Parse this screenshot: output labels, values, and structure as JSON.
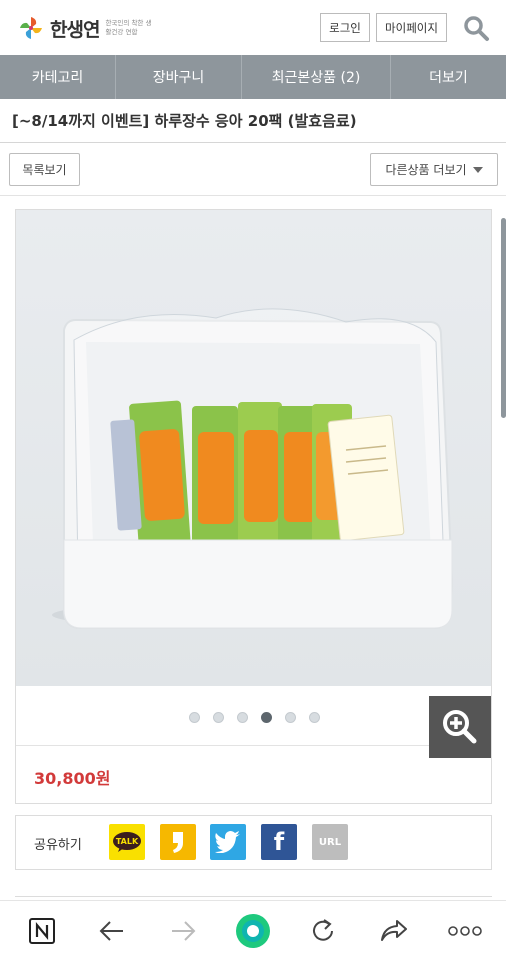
{
  "header": {
    "logo_text": "한생연",
    "logo_sub": "한국인의 착한 생활건강 연합",
    "login_label": "로그인",
    "mypage_label": "마이페이지",
    "search_icon": "search-icon"
  },
  "nav": {
    "items": [
      {
        "label": "카테고리"
      },
      {
        "label": "장바구니"
      },
      {
        "label": "최근본상품 (2)"
      },
      {
        "label": "더보기"
      }
    ]
  },
  "product": {
    "title": "[~8/14까지 이벤트] 하루장수 응아 20팩 (발효음료)",
    "price": "30,800원",
    "image_count": 6,
    "active_image_index": 3
  },
  "actions": {
    "list_label": "목록보기",
    "more_label": "다른상품 더보기"
  },
  "share": {
    "label": "공유하기",
    "kakao_label": "TALK",
    "url_label": "URL",
    "facebook_glyph": "f"
  },
  "browser_toolbar": {
    "icons": [
      "naver-icon",
      "back-arrow-icon",
      "forward-arrow-icon",
      "home-circle-icon",
      "refresh-icon",
      "share-icon",
      "more-icon"
    ]
  },
  "colors": {
    "nav_bg": "#8e969c",
    "price": "#d23a3a",
    "kakao": "#f9e000",
    "story": "#f6b800",
    "twitter": "#2fa7e4",
    "facebook": "#2f5596",
    "url": "#bdbdbd",
    "naver_green": "#1ec97e"
  }
}
